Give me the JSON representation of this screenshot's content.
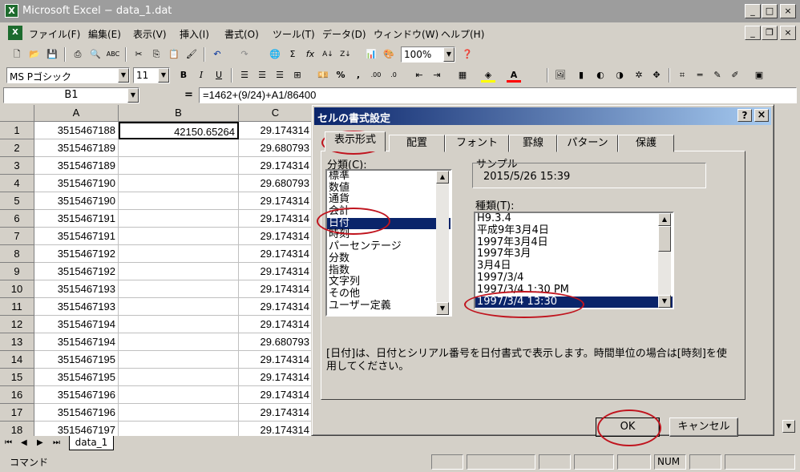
{
  "window": {
    "title": "Microsoft Excel − data_1.dat"
  },
  "menu": [
    "ファイル(F)",
    "編集(E)",
    "表示(V)",
    "挿入(I)",
    "書式(O)",
    "ツール(T)",
    "データ(D)",
    "ウィンドウ(W)",
    "ヘルプ(H)"
  ],
  "toolbar": {
    "zoom": "100%",
    "font_name": "MS Pゴシック",
    "font_size": "11"
  },
  "formula_bar": {
    "name_box": "B1",
    "equals": "=",
    "formula": "=1462+(9/24)+A1/86400"
  },
  "sheet": {
    "columns": [
      "A",
      "B",
      "C"
    ],
    "rows": [
      {
        "n": "1",
        "a": "3515467188",
        "b": "42150.65264",
        "c": "29.174314"
      },
      {
        "n": "2",
        "a": "3515467189",
        "b": "",
        "c": "29.680793"
      },
      {
        "n": "3",
        "a": "3515467189",
        "b": "",
        "c": "29.174314"
      },
      {
        "n": "4",
        "a": "3515467190",
        "b": "",
        "c": "29.680793"
      },
      {
        "n": "5",
        "a": "3515467190",
        "b": "",
        "c": "29.174314"
      },
      {
        "n": "6",
        "a": "3515467191",
        "b": "",
        "c": "29.174314"
      },
      {
        "n": "7",
        "a": "3515467191",
        "b": "",
        "c": "29.174314"
      },
      {
        "n": "8",
        "a": "3515467192",
        "b": "",
        "c": "29.174314"
      },
      {
        "n": "9",
        "a": "3515467192",
        "b": "",
        "c": "29.174314"
      },
      {
        "n": "10",
        "a": "3515467193",
        "b": "",
        "c": "29.174314"
      },
      {
        "n": "11",
        "a": "3515467193",
        "b": "",
        "c": "29.174314"
      },
      {
        "n": "12",
        "a": "3515467194",
        "b": "",
        "c": "29.174314"
      },
      {
        "n": "13",
        "a": "3515467194",
        "b": "",
        "c": "29.680793"
      },
      {
        "n": "14",
        "a": "3515467195",
        "b": "",
        "c": "29.174314"
      },
      {
        "n": "15",
        "a": "3515467195",
        "b": "",
        "c": "29.174314"
      },
      {
        "n": "16",
        "a": "3515467196",
        "b": "",
        "c": "29.174314"
      },
      {
        "n": "17",
        "a": "3515467196",
        "b": "",
        "c": "29.174314"
      },
      {
        "n": "18",
        "a": "3515467197",
        "b": "",
        "c": "29.174314"
      }
    ],
    "tab_name": "data_1"
  },
  "dialog": {
    "title": "セルの書式設定",
    "help": "?",
    "close": "×",
    "tabs": [
      "表示形式",
      "配置",
      "フォント",
      "罫線",
      "パターン",
      "保護"
    ],
    "category_label": "分類(C):",
    "categories": [
      "標準",
      "数値",
      "通貨",
      "会計",
      "日付",
      "時刻",
      "パーセンテージ",
      "分数",
      "指数",
      "文字列",
      "その他",
      "ユーザー定義"
    ],
    "selected_category": "日付",
    "sample_label": "サンプル",
    "sample_value": "2015/5/26 15:39",
    "type_label": "種類(T):",
    "types": [
      "H9.3.4",
      "平成9年3月4日",
      "1997年3月4日",
      "1997年3月",
      "3月4日",
      "1997/3/4",
      "1997/3/4 1:30 PM",
      "1997/3/4 13:30"
    ],
    "selected_type": "1997/3/4 13:30",
    "description": "[日付]は、日付とシリアル番号を日付書式で表示します。時間単位の場合は[時刻]を使用してください。",
    "ok": "OK",
    "cancel": "キャンセル"
  },
  "status": {
    "mode": "コマンド",
    "num": "NUM"
  },
  "colors": {
    "selection": "#0a246a",
    "annotation": "#c0141e"
  }
}
